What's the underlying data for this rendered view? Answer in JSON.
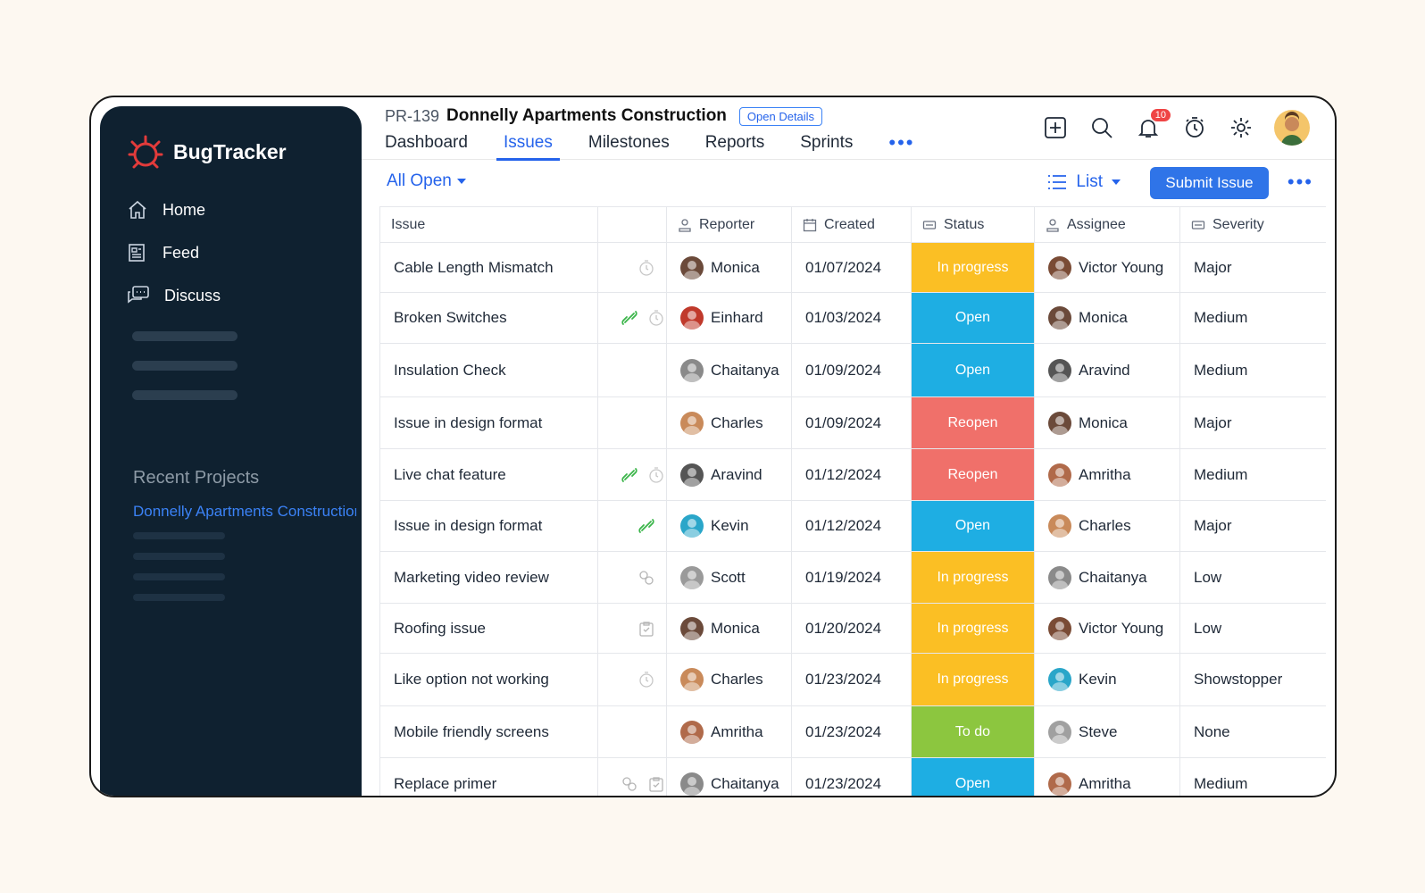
{
  "app": {
    "name": "BugTracker"
  },
  "sidebar": {
    "items": [
      {
        "label": "Home",
        "icon": "home-icon"
      },
      {
        "label": "Feed",
        "icon": "feed-icon"
      },
      {
        "label": "Discuss",
        "icon": "discuss-icon"
      }
    ],
    "recent_title": "Recent Projects",
    "recent_project": "Donnelly Apartments Construction"
  },
  "header": {
    "project_code": "PR-139",
    "project_name": "Donnelly Apartments Construction",
    "open_details": "Open Details",
    "tabs": [
      "Dashboard",
      "Issues",
      "Milestones",
      "Reports",
      "Sprints"
    ],
    "active_tab": "Issues",
    "notification_count": "10"
  },
  "toolbar": {
    "filter": "All Open",
    "view": "List",
    "submit": "Submit Issue"
  },
  "table": {
    "columns": [
      "Issue",
      "",
      "Reporter",
      "Created",
      "Status",
      "Assignee",
      "Severity"
    ],
    "rows": [
      {
        "issue": "Cable Length Mismatch",
        "icons": [
          "timer"
        ],
        "reporter": "Monica",
        "created": "01/07/2024",
        "status": "In progress",
        "assignee": "Victor Young",
        "severity": "Major"
      },
      {
        "issue": "Broken Switches",
        "icons": [
          "link",
          "timer"
        ],
        "reporter": "Einhard",
        "created": "01/03/2024",
        "status": "Open",
        "assignee": "Monica",
        "severity": "Medium"
      },
      {
        "issue": "Insulation Check",
        "icons": [],
        "reporter": "Chaitanya",
        "created": "01/09/2024",
        "status": "Open",
        "assignee": "Aravind",
        "severity": "Medium"
      },
      {
        "issue": "Issue in design format",
        "icons": [],
        "reporter": "Charles",
        "created": "01/09/2024",
        "status": "Reopen",
        "assignee": "Monica",
        "severity": "Major"
      },
      {
        "issue": "Live chat feature",
        "icons": [
          "link",
          "timer"
        ],
        "reporter": "Aravind",
        "created": "01/12/2024",
        "status": "Reopen",
        "assignee": "Amritha",
        "severity": "Medium"
      },
      {
        "issue": "Issue in design format",
        "icons": [
          "link"
        ],
        "reporter": "Kevin",
        "created": "01/12/2024",
        "status": "Open",
        "assignee": "Charles",
        "severity": "Major"
      },
      {
        "issue": "Marketing video review",
        "icons": [
          "chain"
        ],
        "reporter": "Scott",
        "created": "01/19/2024",
        "status": "In progress",
        "assignee": "Chaitanya",
        "severity": "Low"
      },
      {
        "issue": "Roofing issue",
        "icons": [
          "clipboard"
        ],
        "reporter": "Monica",
        "created": "01/20/2024",
        "status": "In progress",
        "assignee": "Victor Young",
        "severity": "Low"
      },
      {
        "issue": "Like option not working",
        "icons": [
          "timer"
        ],
        "reporter": "Charles",
        "created": "01/23/2024",
        "status": "In progress",
        "assignee": "Kevin",
        "severity": "Showstopper"
      },
      {
        "issue": "Mobile friendly screens",
        "icons": [],
        "reporter": "Amritha",
        "created": "01/23/2024",
        "status": "To do",
        "assignee": "Steve",
        "severity": "None"
      },
      {
        "issue": "Replace primer",
        "icons": [
          "chain",
          "clipboard"
        ],
        "reporter": "Chaitanya",
        "created": "01/23/2024",
        "status": "Open",
        "assignee": "Amritha",
        "severity": "Medium"
      }
    ]
  },
  "colors": {
    "In progress": "#fbbf24",
    "Open": "#1eaee3",
    "Reopen": "#f0706a",
    "To do": "#8cc63f",
    "accent": "#2563eb",
    "sidebar": "#0f2130"
  },
  "avatar_colors": {
    "Monica": "#6b4a3a",
    "Einhard": "#c0392b",
    "Chaitanya": "#8a8a8a",
    "Charles": "#c98a5a",
    "Aravind": "#555555",
    "Kevin": "#2aa6c9",
    "Scott": "#9a9a9a",
    "Amritha": "#b06a4a",
    "Victor Young": "#7a4b35",
    "Steve": "#a0a0a0"
  }
}
